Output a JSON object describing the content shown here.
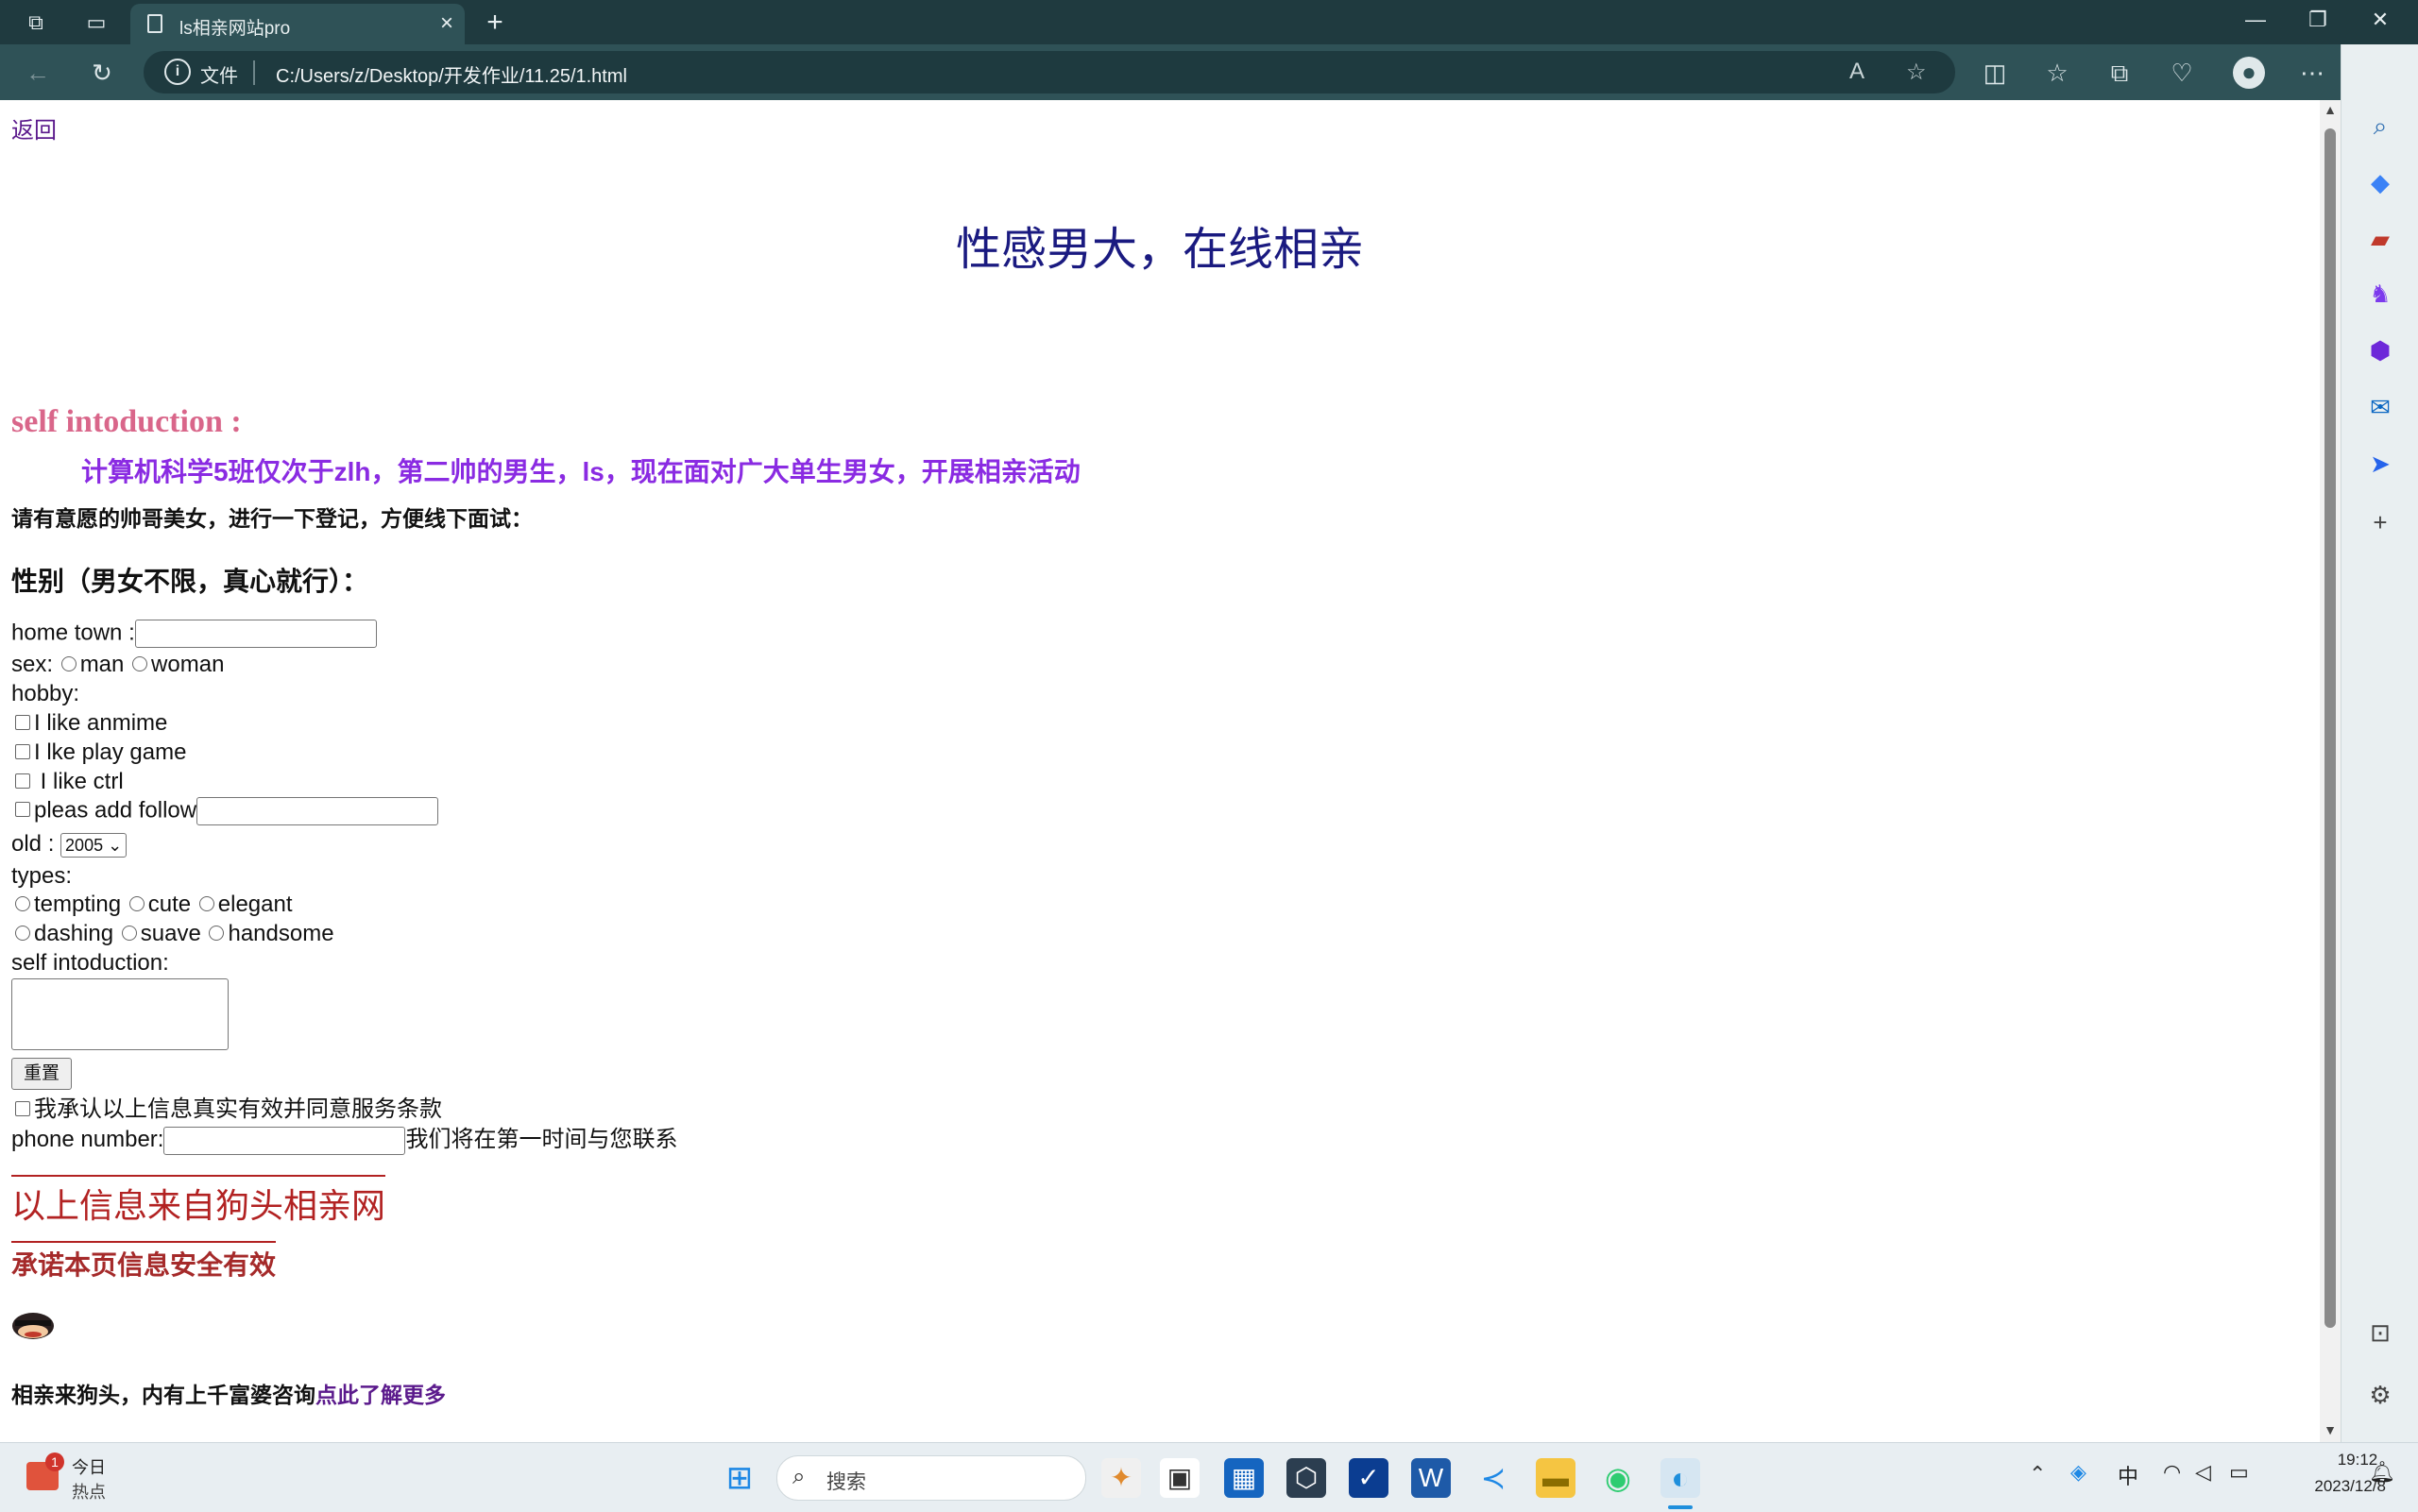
{
  "browser": {
    "tab_title": "ls相亲网站pro",
    "file_label": "文件",
    "url": "C:/Users/z/Desktop/开发作业/11.25/1.html"
  },
  "page": {
    "back_link": "返回",
    "main_title": "性感男大，在线相亲",
    "intro_heading": "self intoduction :",
    "intro_text": "计算机科学5班仅次于zlh，第二帅的男生，ls，现在面对广大单生男女，开展相亲活动",
    "invite_text": "请有意愿的帅哥美女，进行一下登记，方便线下面试：",
    "gender_heading": "性别（男女不限，真心就行）：",
    "hometown_label": "home town :",
    "sex_label": "sex:",
    "sex_options": [
      "man",
      "woman"
    ],
    "hobby_label": "hobby:",
    "hobbies": [
      "I like anmime",
      "I lke play game",
      " I like ctrl",
      "pleas add follow"
    ],
    "old_label": "old :",
    "old_value": "2005",
    "types_label": "types:",
    "types_row1": [
      "tempting",
      "cute",
      "elegant"
    ],
    "types_row2": [
      "dashing",
      "suave",
      "handsome"
    ],
    "self_intro_label": "self intoduction:",
    "reset_button": "重置",
    "agree_text": "我承认以上信息真实有效并同意服务条款",
    "phone_label": "phone number:",
    "phone_note": "我们将在第一时间与您联系",
    "source_text": "以上信息来自狗头相亲网",
    "promise_text": "承诺本页信息安全有效",
    "footer_text": "相亲来狗头，内有上千富婆咨询",
    "footer_link": "点此了解更多"
  },
  "taskbar": {
    "news_badge": "1",
    "news_line1": "今日",
    "news_line2": "热点",
    "search_placeholder": "搜索",
    "ime": "中",
    "time": "19:12",
    "date": "2023/12/8"
  },
  "colors": {
    "title_navy": "#1a1a80",
    "intro_pink": "#d9668a",
    "intro_purple": "#8a2be2",
    "dark_red": "#a52a2a",
    "link_purple": "#5b1a8c"
  }
}
